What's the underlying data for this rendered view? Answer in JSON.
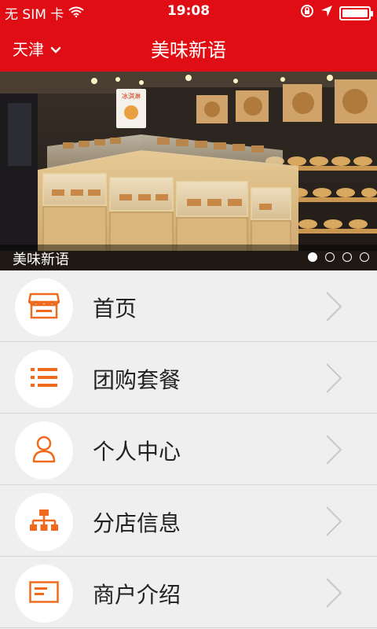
{
  "status_bar": {
    "carrier": "无 SIM 卡",
    "time": "19:08"
  },
  "nav": {
    "city": "天津",
    "title": "美味新语"
  },
  "banner": {
    "caption": "美味新语",
    "slide_count": 4,
    "active_slide": 1,
    "sign_text": "冰淇淋"
  },
  "menu": [
    {
      "label": "首页",
      "icon": "shop-icon"
    },
    {
      "label": "团购套餐",
      "icon": "list-icon"
    },
    {
      "label": "个人中心",
      "icon": "person-icon"
    },
    {
      "label": "分店信息",
      "icon": "branch-icon"
    },
    {
      "label": "商户介绍",
      "icon": "card-icon"
    }
  ],
  "colors": {
    "brand_red": "#e00e14",
    "icon_orange": "#f06a1d",
    "background": "#efefef"
  }
}
